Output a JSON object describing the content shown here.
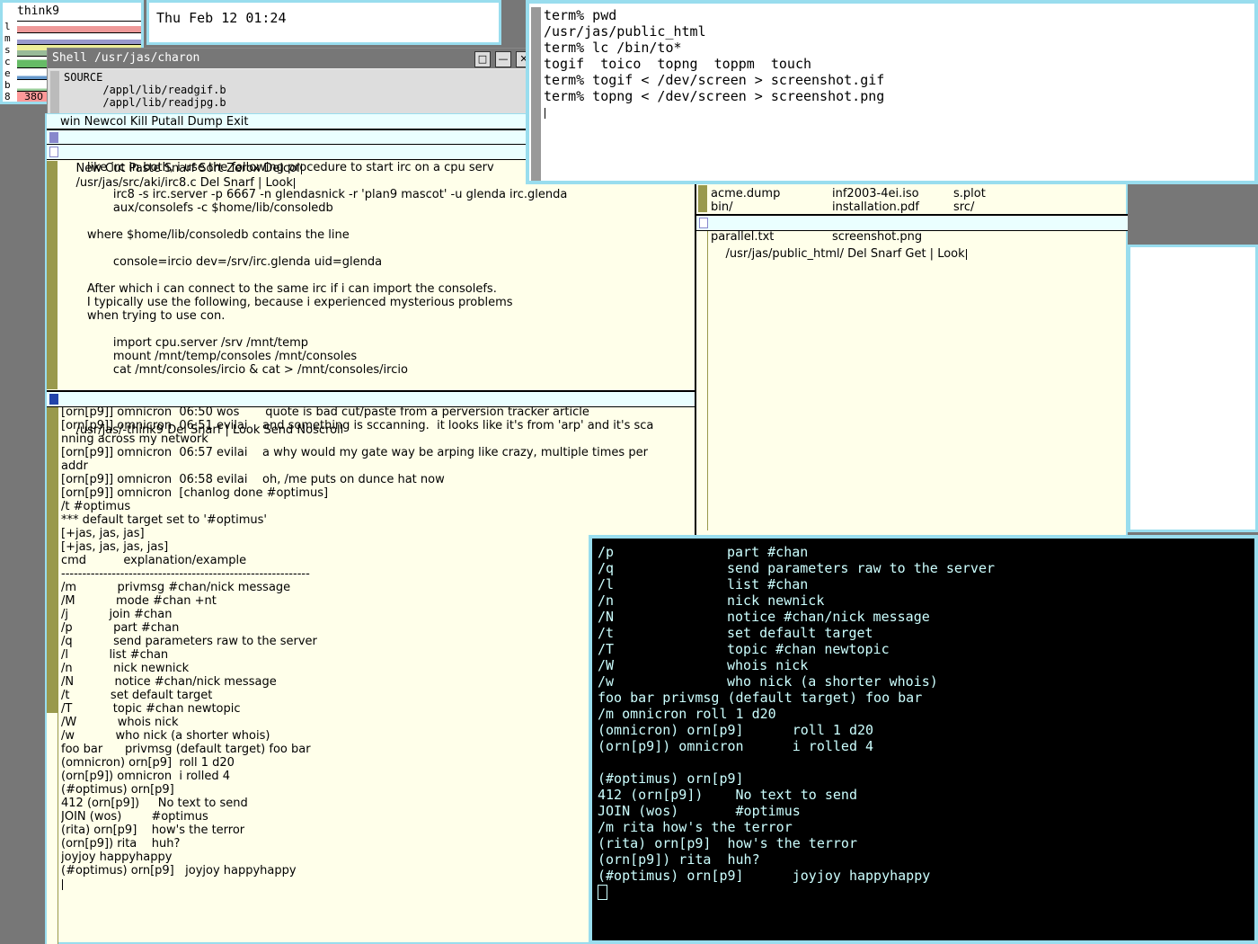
{
  "stats": {
    "title": "think9",
    "labels": [
      "l",
      "m",
      "s",
      "c",
      "e",
      "b",
      "8"
    ],
    "value": "380"
  },
  "clock": {
    "text": "Thu Feb 12 01:24"
  },
  "shell": {
    "title": "Shell /usr/jas/charon",
    "buttons": [
      "□",
      "—",
      "✕"
    ],
    "lines": [
      "SOURCE",
      "      /appl/lib/readgif.b",
      "      /appl/lib/readjpg.b"
    ]
  },
  "acme": {
    "column_tag": "win Newcol Kill Putall Dump Exit",
    "col1_tag": "New Cut Paste Snarf Sort Zerox Delcol",
    "win1": {
      "tag": "/usr/jas/src/aki/irc8.c Del Snarf | Look",
      "lines": [
        "       like irc in both, i use the following procedure to start irc on a cpu serv",
        "",
        "              irc8 -s irc.server -p 6667 -n glendasnick -r 'plan9 mascot' -u glenda irc.glenda",
        "              aux/consolefs -c $home/lib/consoledb",
        "",
        "       where $home/lib/consoledb contains the line",
        "",
        "              console=ircio dev=/srv/irc.glenda uid=glenda",
        "",
        "       After which i can connect to the same irc if i can import the consolefs.",
        "       I typically use the following, because i experienced mysterious problems",
        "       when trying to use con.",
        "",
        "              import cpu.server /srv /mnt/temp",
        "              mount /mnt/temp/consoles /mnt/consoles",
        "              cat /mnt/consoles/ircio & cat > /mnt/consoles/ircio"
      ]
    },
    "win2": {
      "tag": "/usr/jas/-think9 Del Snarf | Look Send Noscroll",
      "lines": [
        "[orn[p9]] omnicron  06:50 wos       quote is bad cut/paste from a perversion tracker article",
        "[orn[p9]] omnicron  06:51 evilai    and something is sccanning.  it looks like it's from 'arp' and it's sca",
        "nning across my network",
        "[orn[p9]] omnicron  06:57 evilai    a why would my gate way be arping like crazy, multiple times per",
        "addr",
        "[orn[p9]] omnicron  06:58 evilai    oh, /me puts on dunce hat now",
        "[orn[p9]] omnicron  [chanlog done #optimus]",
        "/t #optimus",
        "*** default target set to '#optimus'",
        "[+jas, jas, jas]",
        "[+jas, jas, jas, jas]",
        "cmd          explanation/example",
        "-----------------------------------------------------------",
        "/m           privmsg #chan/nick message",
        "/M           mode #chan +nt",
        "/j           join #chan",
        "/p           part #chan",
        "/q           send parameters raw to the server",
        "/l           list #chan",
        "/n           nick newnick",
        "/N           notice #chan/nick message",
        "/t           set default target",
        "/T           topic #chan newtopic",
        "/W           whois nick",
        "/w           who nick (a shorter whois)",
        "foo bar      privmsg (default target) foo bar",
        "(omnicron) orn[p9]  roll 1 d20",
        "(orn[p9]) omnicron  i rolled 4",
        "(#optimus) orn[p9]",
        "412 (orn[p9])     No text to send",
        "JOIN (wos)        #optimus",
        "(rita) orn[p9]    how's the terror",
        "(orn[p9]) rita    huh?",
        "joyjoy happyhappy",
        "(#optimus) orn[p9]   joyjoy happyhappy"
      ]
    },
    "win3": {
      "rows": [
        [
          "acme.dump",
          "inf2003-4ei.iso",
          "s.plot"
        ],
        [
          "bin/",
          "installation.pdf",
          "src/"
        ]
      ]
    },
    "win4": {
      "tag": "/usr/jas/public_html/ Del Snarf Get | Look",
      "rows": [
        [
          "parallel.txt",
          "screenshot.png"
        ]
      ]
    }
  },
  "term1": {
    "lines": [
      "term% pwd",
      "/usr/jas/public_html",
      "term% lc /bin/to*",
      "togif  toico  topng  toppm  touch",
      "term% togif < /dev/screen > screenshot.gif",
      "term% topng < /dev/screen > screenshot.png"
    ]
  },
  "term2": {
    "rows": [
      [
        "/p",
        "part #chan"
      ],
      [
        "/q",
        "send parameters raw to the server"
      ],
      [
        "/l",
        "list #chan"
      ],
      [
        "/n",
        "nick newnick"
      ],
      [
        "/N",
        "notice #chan/nick message"
      ],
      [
        "/t",
        "set default target"
      ],
      [
        "/T",
        "topic #chan newtopic"
      ],
      [
        "/W",
        "whois nick"
      ],
      [
        "/w",
        "who nick (a shorter whois)"
      ]
    ],
    "lines": [
      "foo bar privmsg (default target) foo bar",
      "/m omnicron roll 1 d20",
      "(omnicron) orn[p9]      roll 1 d20",
      "(orn[p9]) omnicron      i rolled 4",
      "",
      "(#optimus) orn[p9]",
      "412 (orn[p9])    No text to send",
      "JOIN (wos)       #optimus",
      "/m rita how's the terror",
      "(rita) orn[p9]  how's the terror",
      "(orn[p9]) rita  huh?",
      "(#optimus) orn[p9]      joyjoy happyhappy"
    ]
  }
}
